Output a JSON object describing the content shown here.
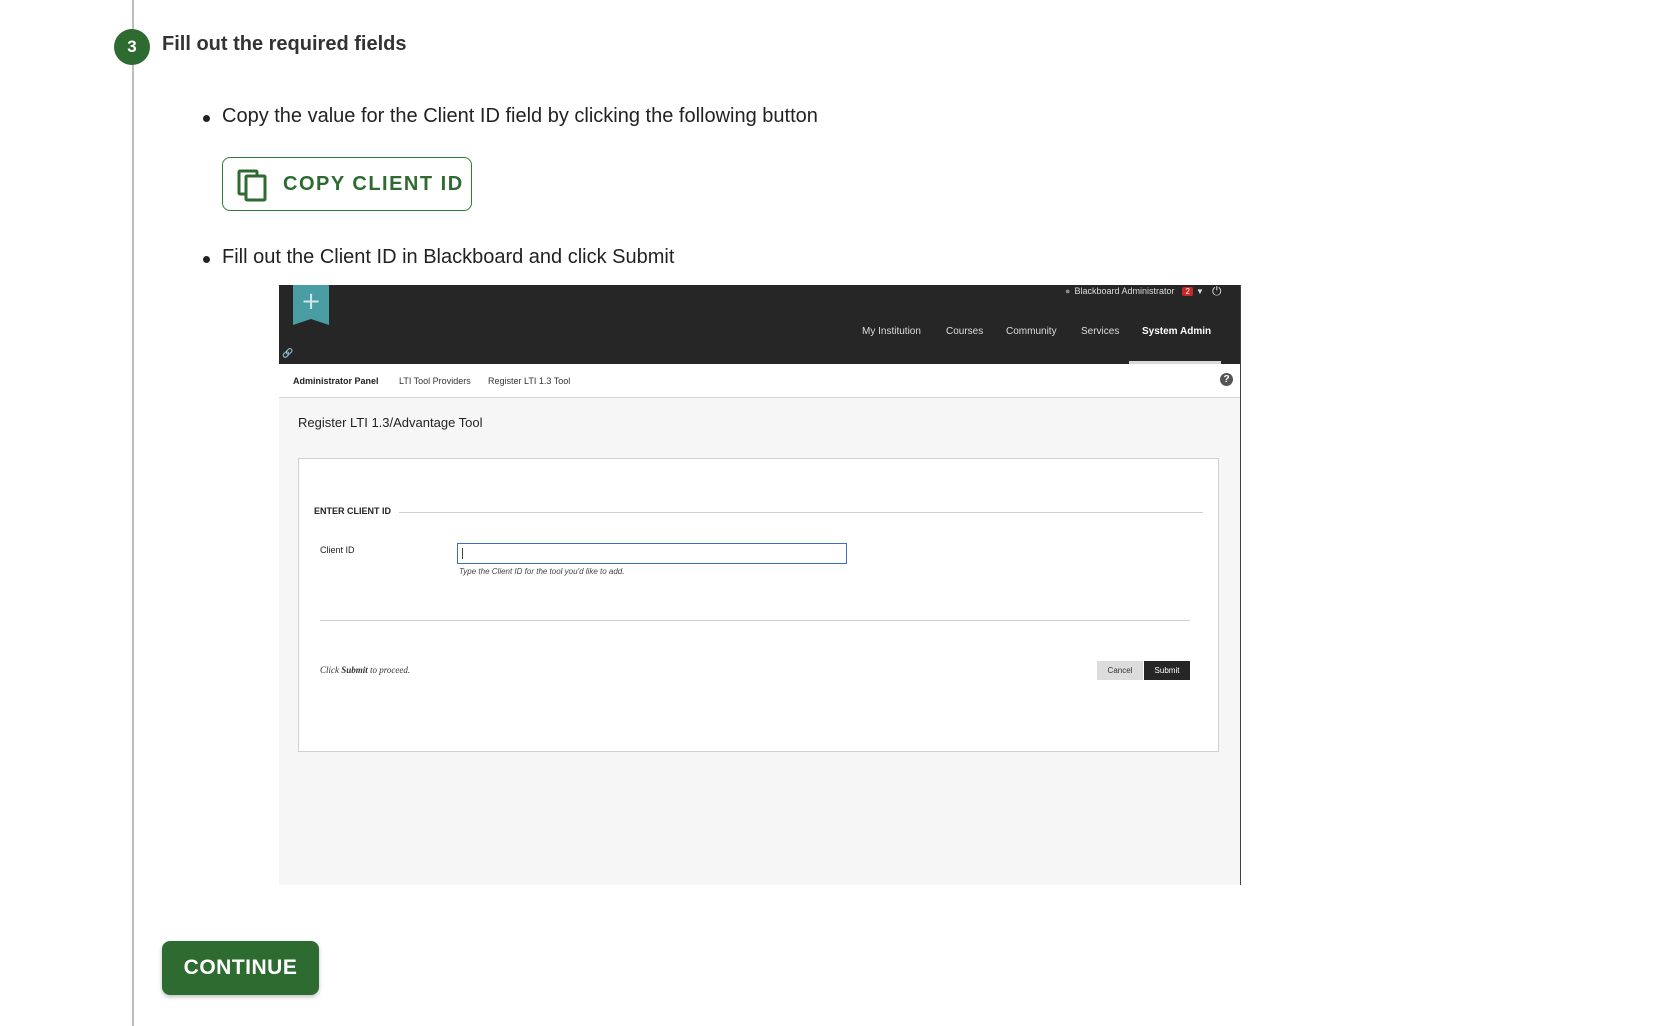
{
  "step": {
    "number": "3",
    "title": "Fill out the required fields"
  },
  "instructions": {
    "copy_text": "Copy the value for the Client ID field by clicking the following button",
    "copy_button_label": "COPY CLIENT ID",
    "fill_text": "Fill out the Client ID in Blackboard and click Submit"
  },
  "screenshot": {
    "user_name": "Blackboard Administrator",
    "notification_count": "2",
    "nav": [
      "My Institution",
      "Courses",
      "Community",
      "Services",
      "System Admin"
    ],
    "active_nav": "System Admin",
    "breadcrumbs": [
      "Administrator Panel",
      "LTI Tool Providers",
      "Register LTI 1.3 Tool"
    ],
    "help": "?",
    "page_title": "Register LTI 1.3/Advantage Tool",
    "section_header": "ENTER CLIENT ID",
    "field_label": "Client ID",
    "field_value": "",
    "field_hint": "Type the Client ID for the tool you'd like to add.",
    "proceed_prefix": "Click ",
    "proceed_bold": "Submit",
    "proceed_suffix": " to proceed.",
    "cancel_label": "Cancel",
    "submit_label": "Submit"
  },
  "continue_label": "CONTINUE",
  "colors": {
    "accent_green": "#2e6b30",
    "bb_header": "#262626",
    "input_focus": "#3a6fc4"
  },
  "icons": [
    "copy-icon",
    "plus-icon",
    "person-icon",
    "power-icon",
    "link-icon",
    "help-icon"
  ]
}
